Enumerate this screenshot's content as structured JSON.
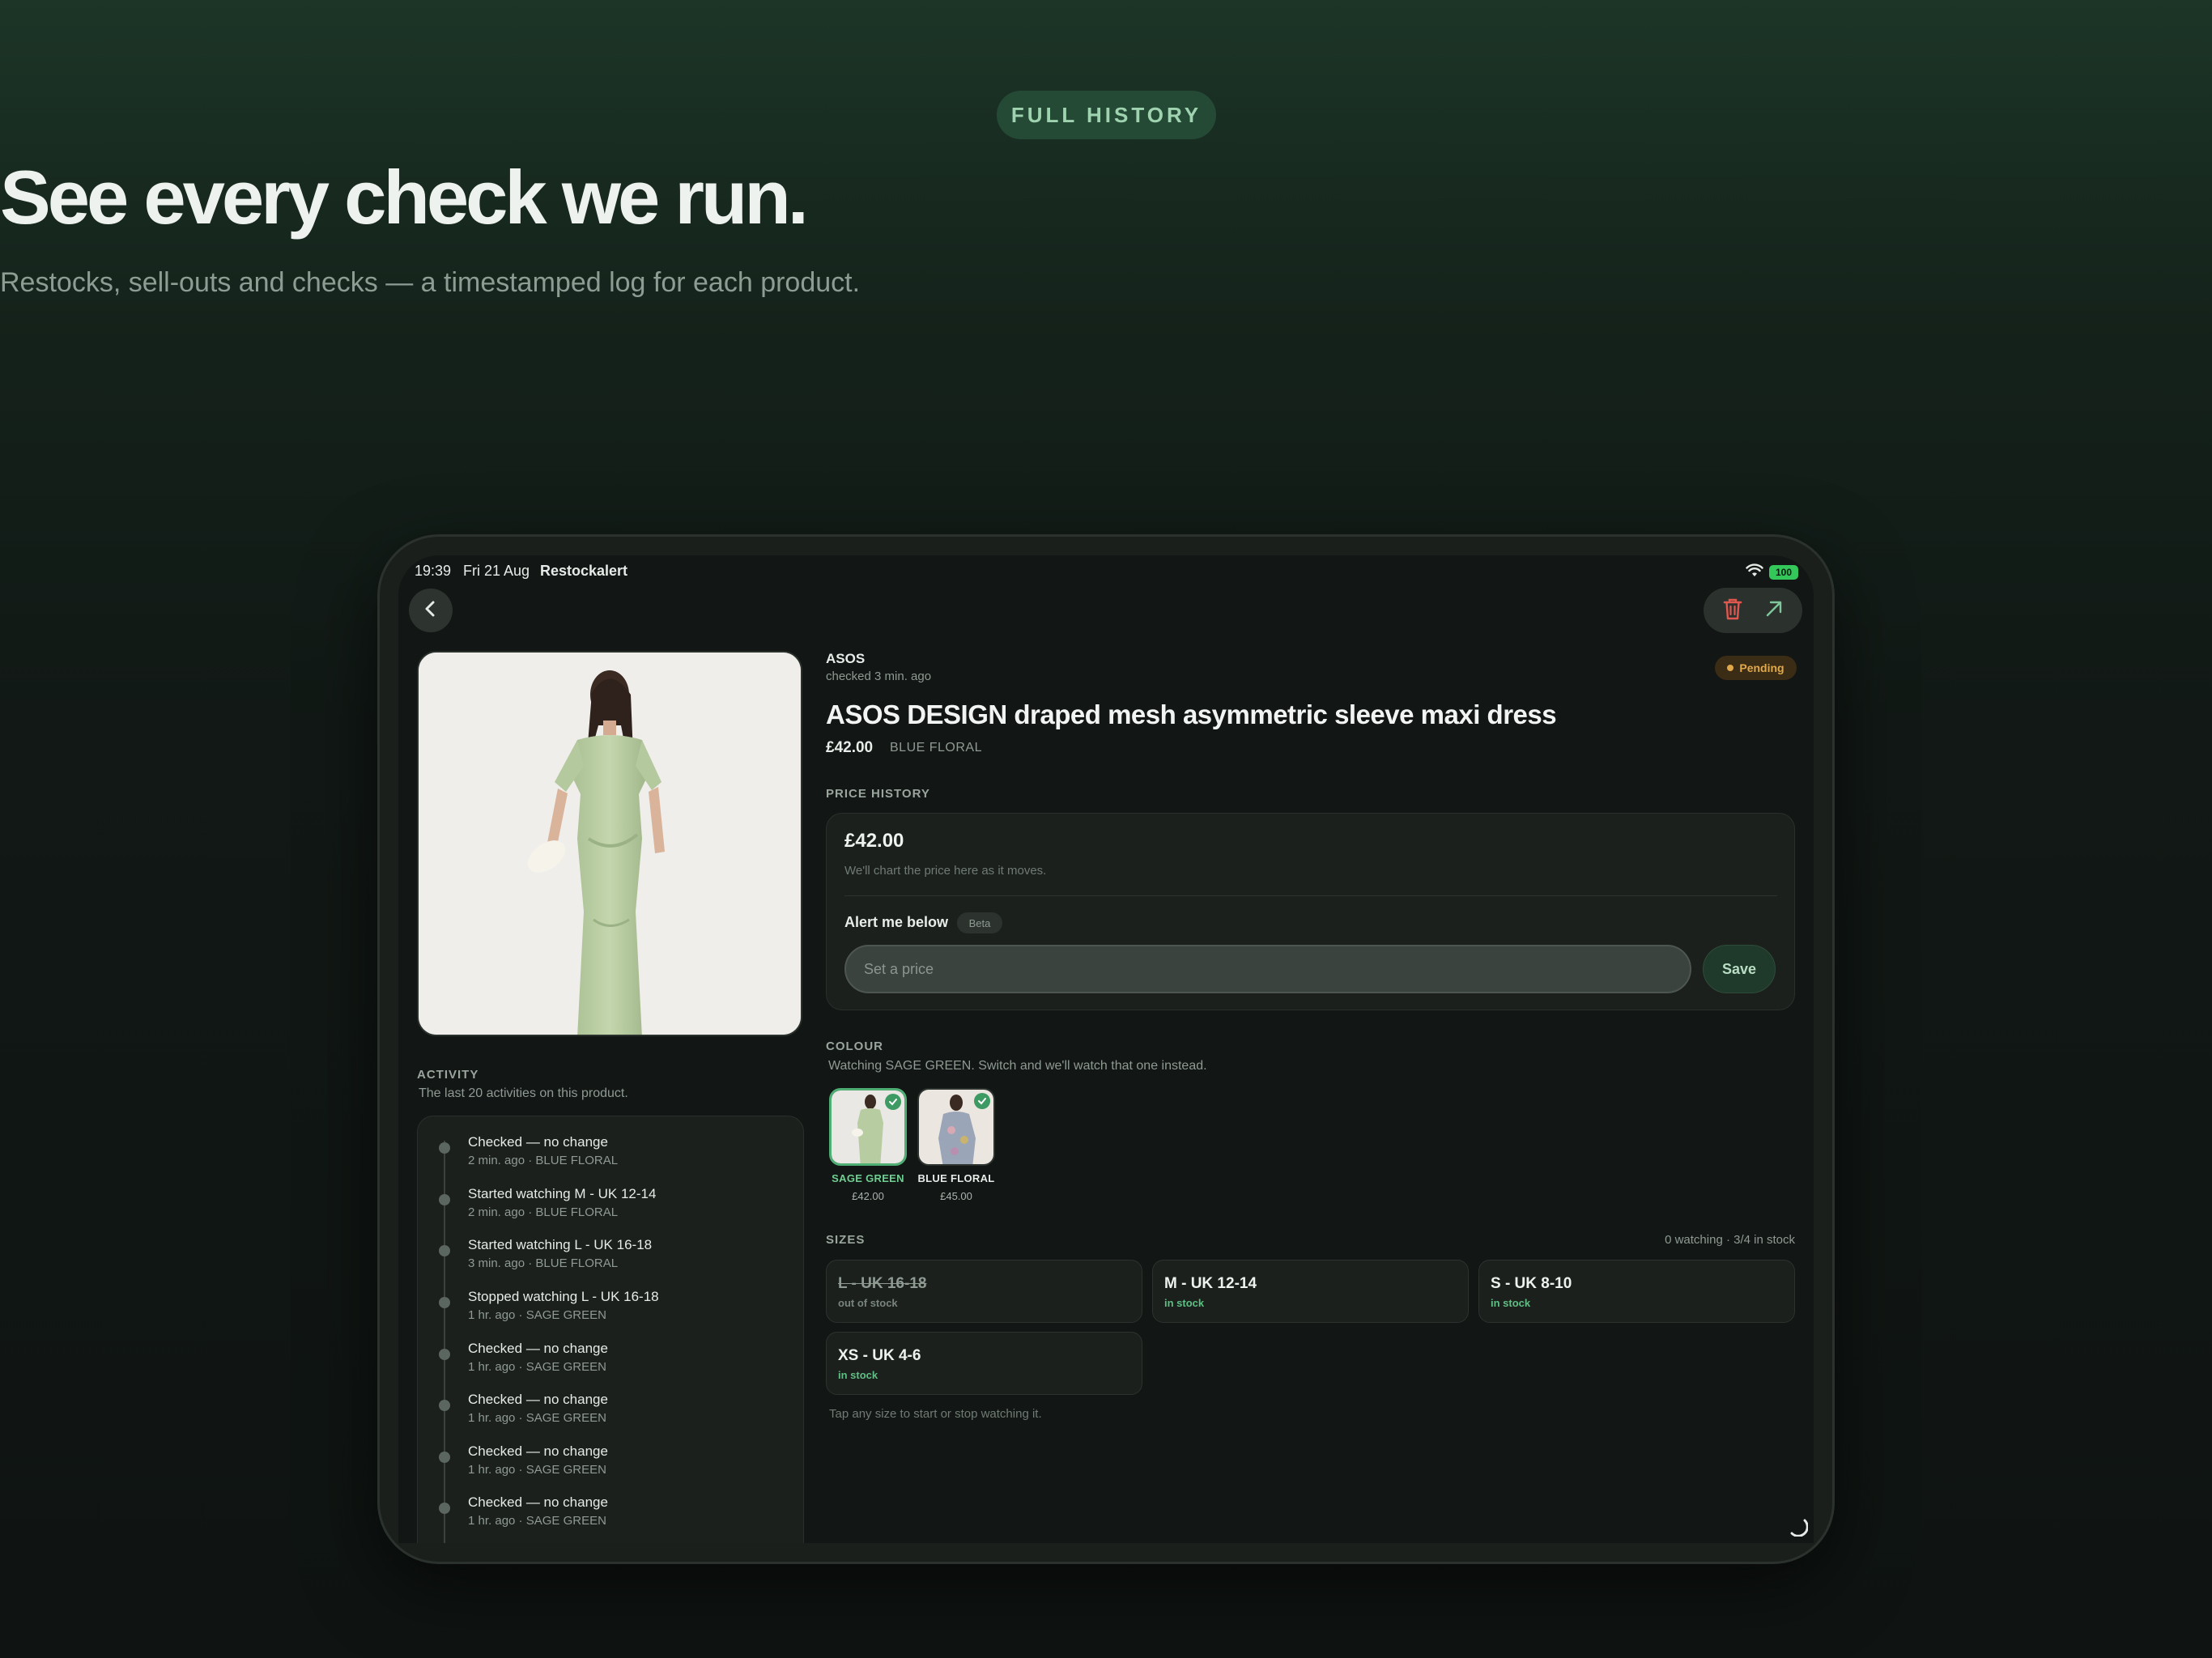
{
  "hero": {
    "eyebrow": "FULL HISTORY",
    "headline": "See every check we run.",
    "subline": "Restocks, sell-outs and checks — a timestamped log for each product."
  },
  "status_bar": {
    "time": "19:39",
    "date": "Fri 21 Aug",
    "app": "Restockalert",
    "battery": "100"
  },
  "product": {
    "brand": "ASOS",
    "checked": "checked 3 min. ago",
    "status": "Pending",
    "title": "ASOS DESIGN draped mesh asymmetric sleeve maxi dress",
    "price": "£42.00",
    "colour": "BLUE FLORAL"
  },
  "price_history": {
    "heading": "PRICE HISTORY",
    "current": "£42.00",
    "note": "We'll chart the price here as it moves.",
    "alert_label": "Alert me below",
    "beta": "Beta",
    "input_placeholder": "Set a price",
    "save": "Save"
  },
  "colour_section": {
    "heading": "COLOUR",
    "note": "Watching SAGE GREEN. Switch and we'll watch that one instead.",
    "options": [
      {
        "name": "SAGE GREEN",
        "price": "£42.00",
        "selected": true
      },
      {
        "name": "BLUE FLORAL",
        "price": "£45.00",
        "selected": false
      }
    ]
  },
  "sizes": {
    "heading": "SIZES",
    "summary": "0 watching · 3/4 in stock",
    "items": [
      {
        "name": "L - UK 16-18",
        "status": "out of stock"
      },
      {
        "name": "M - UK 12-14",
        "status": "in stock"
      },
      {
        "name": "S - UK 8-10",
        "status": "in stock"
      },
      {
        "name": "XS - UK 4-6",
        "status": "in stock"
      }
    ],
    "hint": "Tap any size to start or stop watching it."
  },
  "activity": {
    "heading": "ACTIVITY",
    "note": "The last 20 activities on this product.",
    "items": [
      {
        "title": "Checked — no change",
        "time": "2 min. ago",
        "colour": "BLUE FLORAL"
      },
      {
        "title": "Started watching M - UK 12-14",
        "time": "2 min. ago",
        "colour": "BLUE FLORAL"
      },
      {
        "title": "Started watching L - UK 16-18",
        "time": "3 min. ago",
        "colour": "BLUE FLORAL"
      },
      {
        "title": "Stopped watching L - UK 16-18",
        "time": "1 hr. ago",
        "colour": "SAGE GREEN"
      },
      {
        "title": "Checked — no change",
        "time": "1 hr. ago",
        "colour": "SAGE GREEN"
      },
      {
        "title": "Checked — no change",
        "time": "1 hr. ago",
        "colour": "SAGE GREEN"
      },
      {
        "title": "Checked — no change",
        "time": "1 hr. ago",
        "colour": "SAGE GREEN"
      },
      {
        "title": "Checked — no change",
        "time": "1 hr. ago",
        "colour": "SAGE GREEN"
      }
    ]
  },
  "colors": {
    "accent_green": "#3d9a62",
    "in_stock": "#5fbf83",
    "pending": "#e0a84b",
    "delete_red": "#e0574f"
  },
  "icons": [
    "wifi-icon",
    "chevron-left-icon",
    "trash-icon",
    "external-link-icon",
    "check-icon",
    "loading-spinner-icon"
  ]
}
